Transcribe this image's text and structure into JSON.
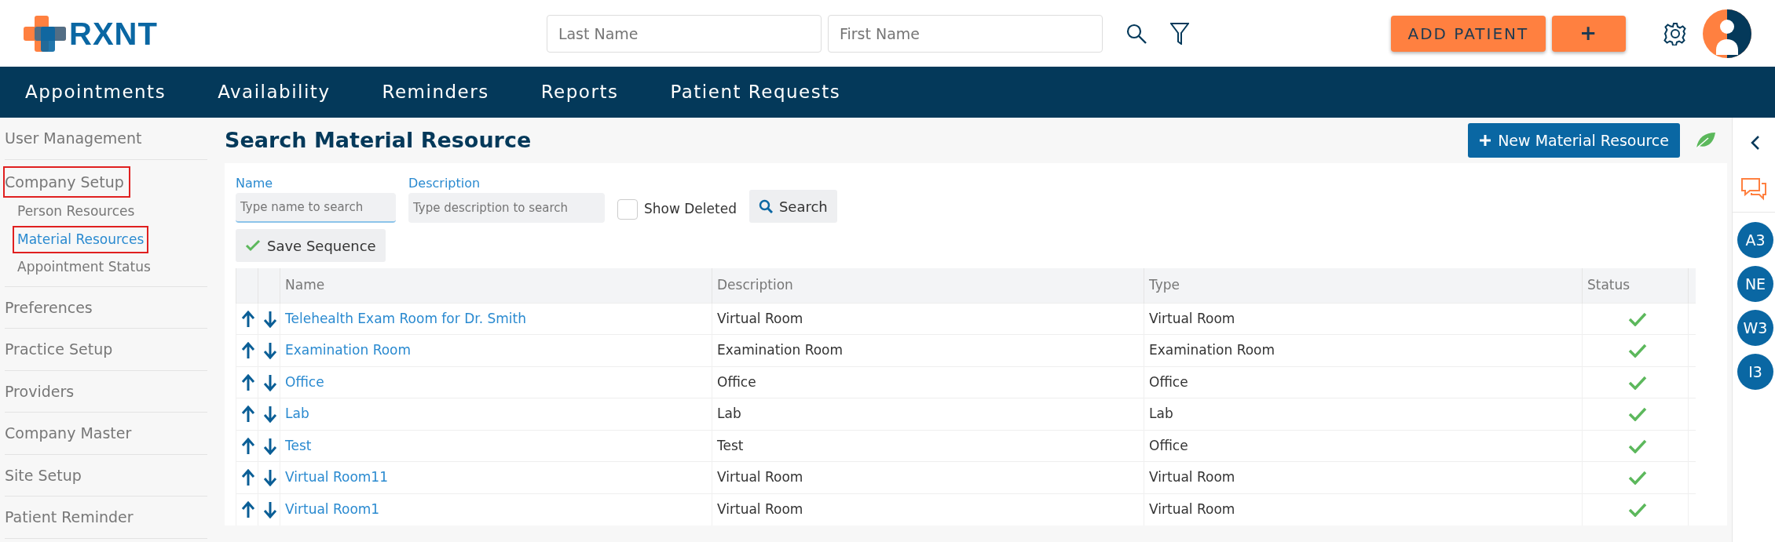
{
  "header": {
    "logo": "RXNT",
    "search_fields": [
      {
        "placeholder": "Last Name"
      },
      {
        "placeholder": "First Name"
      }
    ],
    "buttons": [
      {
        "label": "ADD PATIENT",
        "kind": "text"
      },
      {
        "label": "+",
        "kind": "glyph"
      }
    ]
  },
  "nav": {
    "items": [
      {
        "label": "Appointments"
      },
      {
        "label": "Availability"
      },
      {
        "label": "Reminders"
      },
      {
        "label": "Reports"
      },
      {
        "label": "Patient Requests"
      }
    ]
  },
  "sidebar": {
    "items": [
      {
        "label": "User Management",
        "selected": false,
        "outlined": false
      },
      {
        "label": "Company Setup",
        "selected": false,
        "outlined": true,
        "children": [
          {
            "label": "Person Resources",
            "selected": false,
            "outlined": false
          },
          {
            "label": "Material Resources",
            "selected": true,
            "outlined": true
          },
          {
            "label": "Appointment Status",
            "selected": false,
            "outlined": false
          }
        ]
      },
      {
        "label": "Preferences",
        "selected": false,
        "outlined": false
      },
      {
        "label": "Practice Setup",
        "selected": false,
        "outlined": false
      },
      {
        "label": "Providers",
        "selected": false,
        "outlined": false
      },
      {
        "label": "Company Master",
        "selected": false,
        "outlined": false
      },
      {
        "label": "Site Setup",
        "selected": false,
        "outlined": false
      },
      {
        "label": "Patient Reminder",
        "selected": false,
        "outlined": false
      }
    ]
  },
  "page": {
    "title": "Search Material Resource",
    "new_button": "New Material Resource",
    "filters": {
      "name": {
        "label": "Name",
        "placeholder": "Type name to search",
        "focused": true
      },
      "description": {
        "label": "Description",
        "placeholder": "Type description to search",
        "focused": false
      },
      "show_deleted": {
        "label": "Show Deleted",
        "checked": false
      },
      "search_button": "Search",
      "save_button": "Save Sequence"
    },
    "table": {
      "columns": [
        "Name",
        "Description",
        "Type",
        "Status"
      ],
      "rows": [
        {
          "name": "Telehealth Exam Room for Dr. Smith",
          "description": "Virtual Room",
          "type": "Virtual Room",
          "active": true
        },
        {
          "name": "Examination Room",
          "description": "Examination Room",
          "type": "Examination Room",
          "active": true
        },
        {
          "name": "Office",
          "description": "Office",
          "type": "Office",
          "active": true
        },
        {
          "name": "Lab",
          "description": "Lab",
          "type": "Lab",
          "active": true
        },
        {
          "name": "Test",
          "description": "Test",
          "type": "Office",
          "active": true
        },
        {
          "name": "Virtual Room11",
          "description": "Virtual Room",
          "type": "Virtual Room",
          "active": true
        },
        {
          "name": "Virtual Room1",
          "description": "Virtual Room",
          "type": "Virtual Room",
          "active": true
        }
      ]
    }
  },
  "right_rail": {
    "badges": [
      {
        "label": "A3"
      },
      {
        "label": "NE"
      },
      {
        "label": "W3"
      },
      {
        "label": "I3"
      }
    ]
  }
}
